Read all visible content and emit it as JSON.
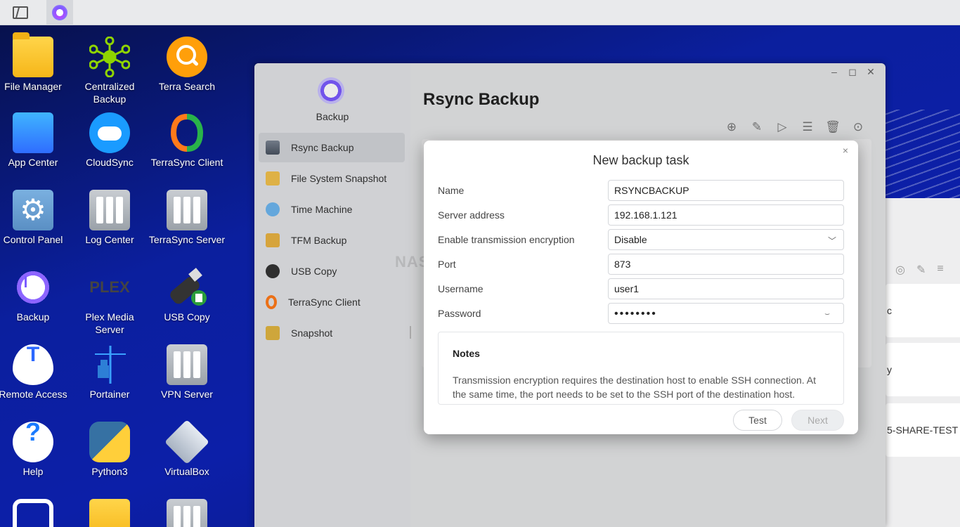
{
  "desktop": {
    "apps": [
      {
        "label": "File Manager",
        "icon": "folder-icon"
      },
      {
        "label": "Centralized Backup",
        "icon": "network-icon"
      },
      {
        "label": "Terra Search",
        "icon": "search-icon"
      },
      {
        "label": "App Center",
        "icon": "shopping-bag-icon"
      },
      {
        "label": "CloudSync",
        "icon": "cloud-icon"
      },
      {
        "label": "TerraSync Client",
        "icon": "sync-icon"
      },
      {
        "label": "Control Panel",
        "icon": "gear-icon"
      },
      {
        "label": "Log Center",
        "icon": "server-log-icon"
      },
      {
        "label": "TerraSync Server",
        "icon": "server-sync-icon"
      },
      {
        "label": "Backup",
        "icon": "clock-icon"
      },
      {
        "label": "Plex Media Server",
        "icon": "plex-icon"
      },
      {
        "label": "USB Copy",
        "icon": "usb-icon"
      },
      {
        "label": "Remote Access",
        "icon": "remote-icon"
      },
      {
        "label": "Portainer",
        "icon": "crane-icon"
      },
      {
        "label": "VPN Server",
        "icon": "shield-icon"
      },
      {
        "label": "Help",
        "icon": "help-icon"
      },
      {
        "label": "Python3",
        "icon": "python-icon"
      },
      {
        "label": "VirtualBox",
        "icon": "virtualbox-icon"
      }
    ],
    "plex_text": "PLEX"
  },
  "window": {
    "sidebar_title": "Backup",
    "sidebar_items": [
      {
        "label": "Rsync Backup",
        "icon": "rsync-icon"
      },
      {
        "label": "File System Snapshot",
        "icon": "snapshot-icon"
      },
      {
        "label": "Time Machine",
        "icon": "time-machine-icon"
      },
      {
        "label": "TFM Backup",
        "icon": "tfm-icon"
      },
      {
        "label": "USB Copy",
        "icon": "usb-icon"
      },
      {
        "label": "TerraSync Client",
        "icon": "sync-icon"
      },
      {
        "label": "Snapshot",
        "icon": "camera-folder-icon"
      }
    ],
    "main_title": "Rsync Backup",
    "watermark": "NAS COMPARES",
    "controls": {
      "minimize": "–",
      "maximize": "◻",
      "close": "✕"
    }
  },
  "right_panel": {
    "cards": [
      "c",
      "y",
      "5-SHARE-TEST"
    ]
  },
  "dialog": {
    "title": "New backup task",
    "close": "×",
    "fields": {
      "name": {
        "label": "Name",
        "value": "RSYNCBACKUP"
      },
      "server": {
        "label": "Server address",
        "value": "192.168.1.121"
      },
      "encryption": {
        "label": "Enable transmission encryption",
        "value": "Disable"
      },
      "port": {
        "label": "Port",
        "value": "873"
      },
      "username": {
        "label": "Username",
        "value": "user1"
      },
      "password": {
        "label": "Password",
        "value": "••••••••"
      }
    },
    "notes_title": "Notes",
    "notes_text": "Transmission encryption requires the destination host to enable SSH connection. At the same time, the port needs to be set to the SSH port of the destination host.",
    "test_button": "Test",
    "next_button": "Next"
  }
}
